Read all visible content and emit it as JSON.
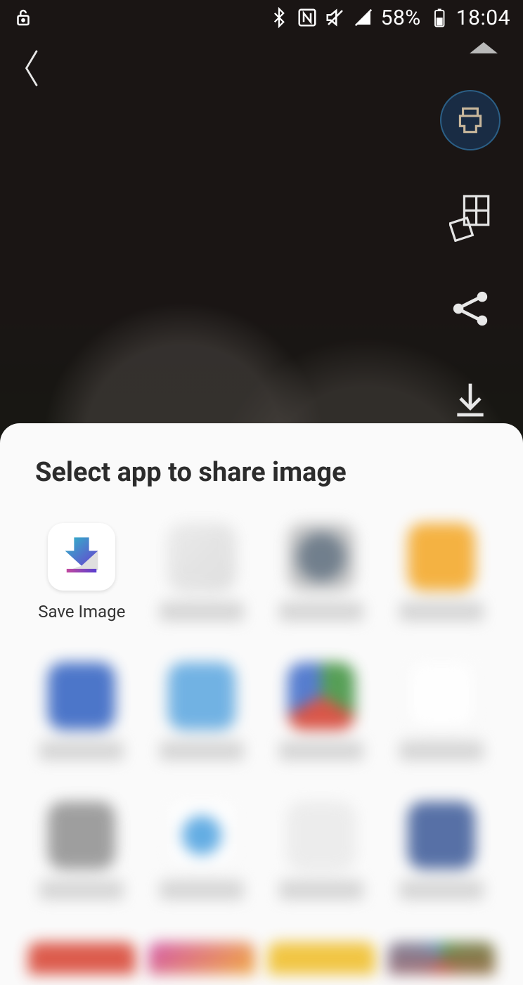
{
  "status": {
    "battery_pct": "58%",
    "time": "18:04"
  },
  "sheet": {
    "title": "Select app to share image",
    "apps": [
      {
        "label": "Save Image"
      }
    ]
  }
}
